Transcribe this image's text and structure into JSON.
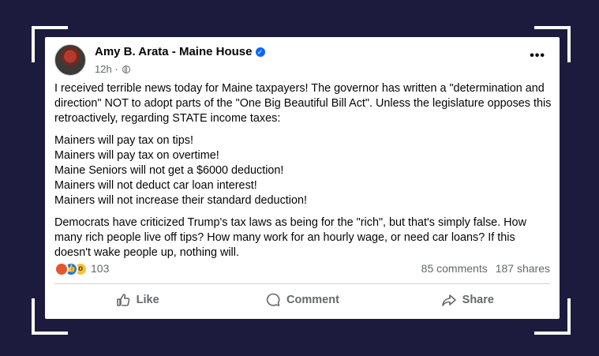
{
  "post": {
    "author": "Amy B. Arata - Maine House",
    "verified_icon": "verified-badge-icon",
    "time": "12h",
    "audience_icon": "globe-icon",
    "more_icon": "more-options-icon",
    "paragraph1": "I received terrible news today for Maine taxpayers! The governor has written a \"determination and direction\" NOT to adopt parts of the \"One Big Beautiful Bill Act\".  Unless the legislature opposes this retroactively, regarding STATE income taxes:",
    "list": [
      "Mainers will pay tax on tips!",
      "Mainers will pay tax on overtime!",
      "Maine Seniors will not get a $6000 deduction!",
      "Mainers will not deduct car loan interest!",
      "Mainers will not increase their standard deduction!"
    ],
    "paragraph2": "Democrats have criticized Trump's tax laws as being for the \"rich\", but that's simply false. How many rich people live off tips? How many work for an hourly wage, or need car loans? If this doesn't wake people up, nothing will."
  },
  "engagement": {
    "reaction_icons": [
      "angry-reaction-icon",
      "like-reaction-icon",
      "wow-reaction-icon"
    ],
    "reaction_count": "103",
    "comments": "85 comments",
    "shares": "187 shares"
  },
  "actions": {
    "like": "Like",
    "comment": "Comment",
    "share": "Share"
  },
  "colors": {
    "background": "#1d1b3d",
    "card": "#ffffff",
    "secondary_text": "#65676b",
    "verified": "#0866ff"
  }
}
